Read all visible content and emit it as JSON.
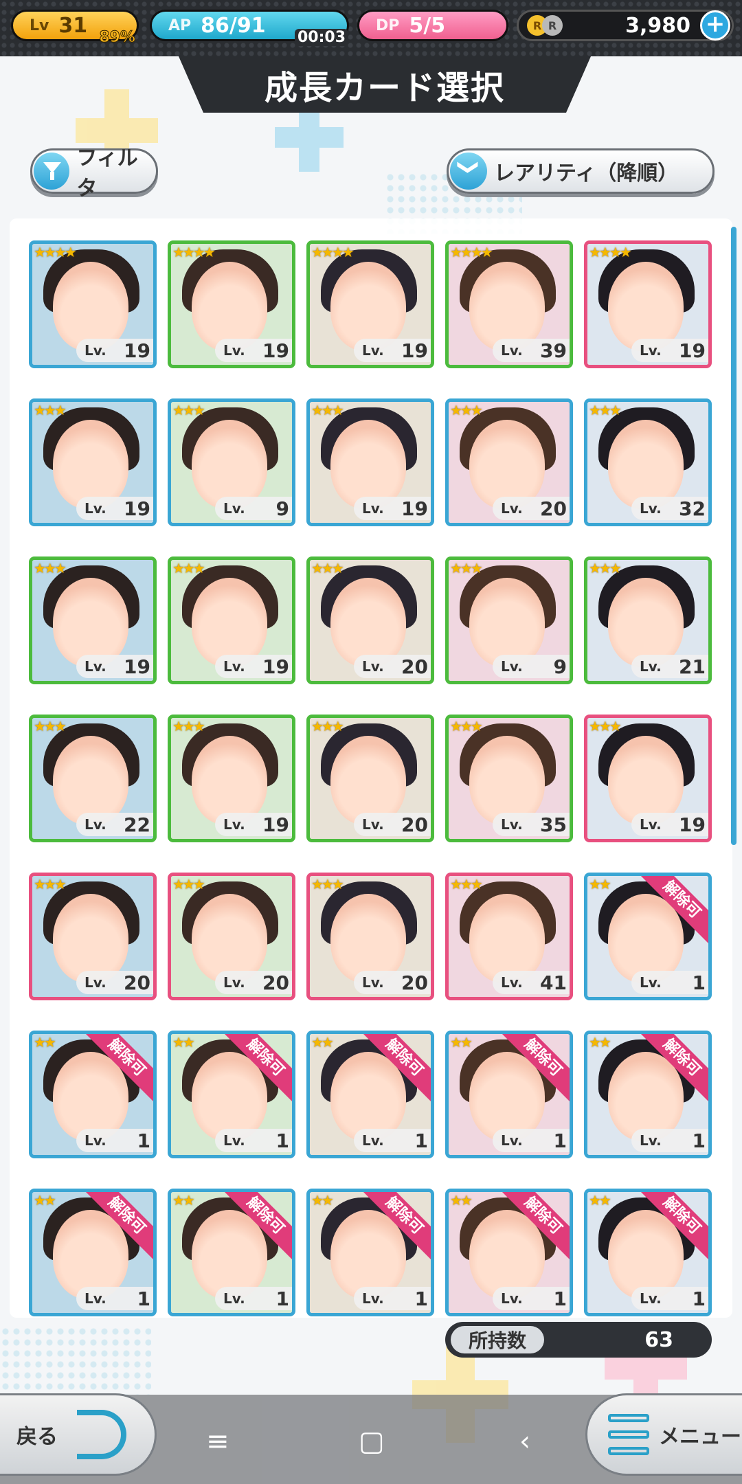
{
  "topbar": {
    "level": {
      "tag": "Lv",
      "value": "31",
      "percent": "89%",
      "progress": 0.89
    },
    "ap": {
      "tag": "AP",
      "value": "86/91",
      "timer": "00:03",
      "progress": 0.945
    },
    "dp": {
      "tag": "DP",
      "value": "5/5"
    },
    "currency": {
      "coin1": "R",
      "coin2": "R",
      "value": "3,980",
      "add_label": "+"
    }
  },
  "title": "成長カード選択",
  "controls": {
    "filter_label": "フィルタ",
    "sort_label": "レアリティ（降順）"
  },
  "cards": [
    {
      "stars": "★★★★",
      "lv_label": "Lv.",
      "level": "19",
      "frame": "blue"
    },
    {
      "stars": "★★★★",
      "lv_label": "Lv.",
      "level": "19",
      "frame": "green"
    },
    {
      "stars": "★★★★",
      "lv_label": "Lv.",
      "level": "19",
      "frame": "green"
    },
    {
      "stars": "★★★★",
      "lv_label": "Lv.",
      "level": "39",
      "frame": "green"
    },
    {
      "stars": "★★★★",
      "lv_label": "Lv.",
      "level": "19",
      "frame": "pink"
    },
    {
      "stars": "★★★",
      "lv_label": "Lv.",
      "level": "19",
      "frame": "blue"
    },
    {
      "stars": "★★★",
      "lv_label": "Lv.",
      "level": "9",
      "frame": "blue"
    },
    {
      "stars": "★★★",
      "lv_label": "Lv.",
      "level": "19",
      "frame": "blue"
    },
    {
      "stars": "★★★",
      "lv_label": "Lv.",
      "level": "20",
      "frame": "blue"
    },
    {
      "stars": "★★★",
      "lv_label": "Lv.",
      "level": "32",
      "frame": "blue"
    },
    {
      "stars": "★★★",
      "lv_label": "Lv.",
      "level": "19",
      "frame": "green"
    },
    {
      "stars": "★★★",
      "lv_label": "Lv.",
      "level": "19",
      "frame": "green"
    },
    {
      "stars": "★★★",
      "lv_label": "Lv.",
      "level": "20",
      "frame": "green"
    },
    {
      "stars": "★★★",
      "lv_label": "Lv.",
      "level": "9",
      "frame": "green"
    },
    {
      "stars": "★★★",
      "lv_label": "Lv.",
      "level": "21",
      "frame": "green"
    },
    {
      "stars": "★★★",
      "lv_label": "Lv.",
      "level": "22",
      "frame": "green"
    },
    {
      "stars": "★★★",
      "lv_label": "Lv.",
      "level": "19",
      "frame": "green"
    },
    {
      "stars": "★★★",
      "lv_label": "Lv.",
      "level": "20",
      "frame": "green"
    },
    {
      "stars": "★★★",
      "lv_label": "Lv.",
      "level": "35",
      "frame": "green"
    },
    {
      "stars": "★★★",
      "lv_label": "Lv.",
      "level": "19",
      "frame": "pink"
    },
    {
      "stars": "★★★",
      "lv_label": "Lv.",
      "level": "20",
      "frame": "pink"
    },
    {
      "stars": "★★★",
      "lv_label": "Lv.",
      "level": "20",
      "frame": "pink"
    },
    {
      "stars": "★★★",
      "lv_label": "Lv.",
      "level": "20",
      "frame": "pink"
    },
    {
      "stars": "★★★",
      "lv_label": "Lv.",
      "level": "41",
      "frame": "pink"
    },
    {
      "stars": "★★",
      "lv_label": "Lv.",
      "level": "1",
      "frame": "blue",
      "ribbon": "解除可"
    },
    {
      "stars": "★★",
      "lv_label": "Lv.",
      "level": "1",
      "frame": "blue",
      "ribbon": "解除可"
    },
    {
      "stars": "★★",
      "lv_label": "Lv.",
      "level": "1",
      "frame": "blue",
      "ribbon": "解除可"
    },
    {
      "stars": "★★",
      "lv_label": "Lv.",
      "level": "1",
      "frame": "blue",
      "ribbon": "解除可"
    },
    {
      "stars": "★★",
      "lv_label": "Lv.",
      "level": "1",
      "frame": "blue",
      "ribbon": "解除可"
    },
    {
      "stars": "★★",
      "lv_label": "Lv.",
      "level": "1",
      "frame": "blue",
      "ribbon": "解除可"
    },
    {
      "stars": "★★",
      "lv_label": "Lv.",
      "level": "1",
      "frame": "blue",
      "ribbon": "解除可"
    },
    {
      "stars": "★★",
      "lv_label": "Lv.",
      "level": "1",
      "frame": "blue",
      "ribbon": "解除可"
    },
    {
      "stars": "★★",
      "lv_label": "Lv.",
      "level": "1",
      "frame": "blue",
      "ribbon": "解除可"
    },
    {
      "stars": "★★",
      "lv_label": "Lv.",
      "level": "1",
      "frame": "blue",
      "ribbon": "解除可"
    },
    {
      "stars": "★★",
      "lv_label": "Lv.",
      "level": "1",
      "frame": "blue",
      "ribbon": "解除可"
    }
  ],
  "owned": {
    "label": "所持数",
    "count": "63"
  },
  "nav": {
    "back_label": "戻る",
    "menu_label": "メニュー"
  },
  "colors": {
    "blue": "#3aa6d4",
    "green": "#4cbb3d",
    "pink": "#e8507f",
    "ribbon": "#e03c7a"
  }
}
